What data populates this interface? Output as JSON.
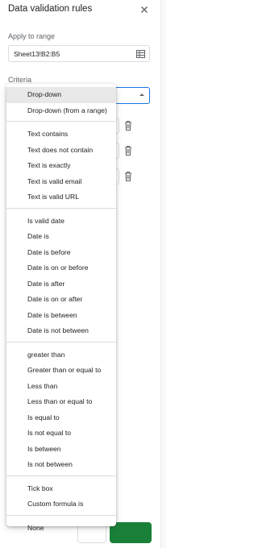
{
  "panel": {
    "title": "Data validation rules",
    "close_icon": "close-icon"
  },
  "apply_to_range": {
    "label": "Apply to range",
    "value": "Sheet13!B2:B5",
    "icon": "grid-icon"
  },
  "criteria": {
    "label": "Criteria",
    "selected": "Drop-down"
  },
  "menu": {
    "groups": [
      {
        "items": [
          "Drop-down",
          "Drop-down (from a range)"
        ]
      },
      {
        "items": [
          "Text contains",
          "Text does not contain",
          "Text is exactly",
          "Text is valid email",
          "Text is valid URL"
        ]
      },
      {
        "items": [
          "Is valid date",
          "Date is",
          "Date is before",
          "Date is on or before",
          "Date is after",
          "Date is on or after",
          "Date is between",
          "Date is not between"
        ]
      },
      {
        "items": [
          "greater than",
          "Greater than or equal to",
          "Less than",
          "Less than or equal to",
          "Is equal to",
          "Is not equal to",
          "Is between",
          "Is not between"
        ]
      },
      {
        "items": [
          "Tick box",
          "Custom formula is"
        ]
      },
      {
        "items": [
          "None"
        ]
      }
    ]
  },
  "colors": {
    "accent": "#1a73e8",
    "selected_bg": "#e8e8e8",
    "done_button": "#188038"
  }
}
